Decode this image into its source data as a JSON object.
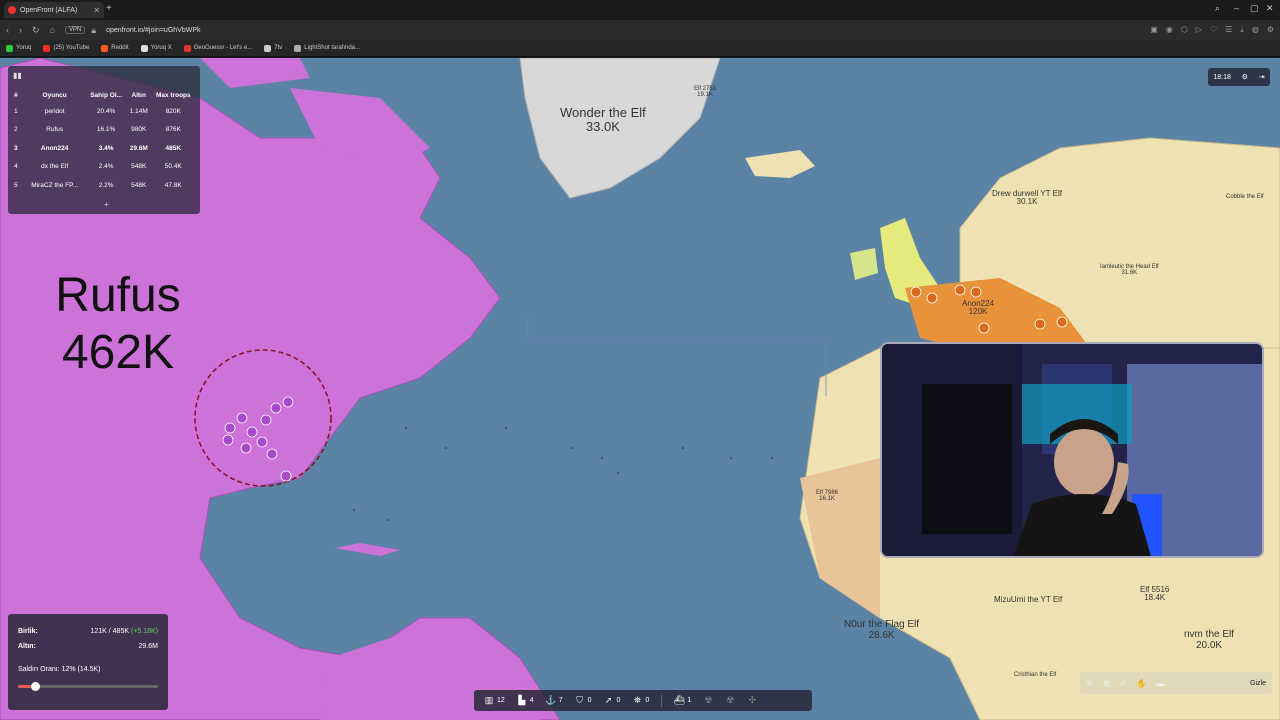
{
  "browser": {
    "tab_title": "OpenFront (ALFA)",
    "new_tab": "+",
    "url": "openfront.io/#join=uGhVbWPk",
    "vpn_label": "VPN",
    "bookmarks": [
      {
        "label": "Yoruq",
        "color": "#2ecc40"
      },
      {
        "label": "(25) YouTube",
        "color": "#ff2a2a"
      },
      {
        "label": "Reddit",
        "color": "#ff5a1f"
      },
      {
        "label": "Yoruq X",
        "color": "#dddddd"
      },
      {
        "label": "GeoGuessr - Let's e...",
        "color": "#e0362c"
      },
      {
        "label": "7tv",
        "color": "#cccccc"
      },
      {
        "label": "LightShot tarafında...",
        "color": "#aaaaaa"
      }
    ]
  },
  "leaderboard": {
    "headers": [
      "#",
      "Oyuncu",
      "Sahip Ol...",
      "Altın",
      "Max troops"
    ],
    "rows": [
      [
        "1",
        "peridot",
        "20.4%",
        "1.14M",
        "820K"
      ],
      [
        "2",
        "Rufus",
        "16.1%",
        "980K",
        "876K"
      ],
      [
        "3",
        "Anon224",
        "3.4%",
        "29.6M",
        "485K"
      ],
      [
        "4",
        "dx the Elf",
        "2.4%",
        "548K",
        "50.4K"
      ],
      [
        "5",
        "MiraCZ the FP...",
        "2.2%",
        "548K",
        "47.8K"
      ]
    ],
    "highlight_row": 2,
    "expand": "+"
  },
  "timer": {
    "time": "18:18"
  },
  "map_labels": {
    "wonder": {
      "name": "Wonder the Elf",
      "troops": "33.0K"
    },
    "elf_top": {
      "name": "Elf 2753",
      "troops": "19.1K"
    },
    "drew": {
      "name": "Drew durwell YT Elf",
      "troops": "30.1K"
    },
    "cobble": {
      "name": "Cobble the Elf",
      "troops": ""
    },
    "iamleutic": {
      "name": "Iamleutic the Head Elf",
      "troops": "31.6K"
    },
    "anon": {
      "name": "Anon224",
      "troops": "120K"
    },
    "elf7986": {
      "name": "Elf 7986",
      "troops": "16.1K"
    },
    "mizu": {
      "name": "MizuUmi the YT Elf",
      "troops": ""
    },
    "elf5516": {
      "name": "Elf 5516",
      "troops": "18.4K"
    },
    "noor": {
      "name": "N0ur the Flag Elf",
      "troops": "28.6K"
    },
    "nvm": {
      "name": "nvm the Elf",
      "troops": "20.0K"
    },
    "cristhian": {
      "name": "Cristhian the Elf",
      "troops": ""
    }
  },
  "overlay": {
    "name": "Rufus",
    "troops": "462K"
  },
  "stats": {
    "units_label": "Birlik:",
    "units_value": "121K / 485K",
    "units_gain": "(+5.18K)",
    "gold_label": "Altın:",
    "gold_value": "29.6M",
    "attack_label": "Saldırı Oranı: 12% (14.5K)",
    "attack_ratio": 0.12
  },
  "buildbar": {
    "items": [
      {
        "icon": "city-icon",
        "glyph": "▥",
        "count": "12",
        "dim": false
      },
      {
        "icon": "factory-icon",
        "glyph": "▙",
        "count": "4",
        "dim": false
      },
      {
        "icon": "port-icon",
        "glyph": "⚓",
        "count": "7",
        "dim": false
      },
      {
        "icon": "defense-post-icon",
        "glyph": "⛉",
        "count": "0",
        "dim": false
      },
      {
        "icon": "missile-silo-icon",
        "glyph": "➚",
        "count": "0",
        "dim": false
      },
      {
        "icon": "sam-launcher-icon",
        "glyph": "⛯",
        "count": "0",
        "dim": false
      },
      {
        "icon": "warship-icon",
        "glyph": "⛴",
        "count": "1",
        "dim": false
      },
      {
        "icon": "atom-bomb-icon",
        "glyph": "☢",
        "count": "",
        "dim": true
      },
      {
        "icon": "hydrogen-bomb-icon",
        "glyph": "☢",
        "count": "",
        "dim": true
      },
      {
        "icon": "mirv-icon",
        "glyph": "✣",
        "count": "",
        "dim": true
      }
    ]
  },
  "emojibar": {
    "hide_label": "Gizle"
  },
  "colors": {
    "ocean": "#5a83a5",
    "purple_territory": "#cc72d8",
    "orange_territory": "#e8933a",
    "land_neutral": "#efe2b2"
  }
}
